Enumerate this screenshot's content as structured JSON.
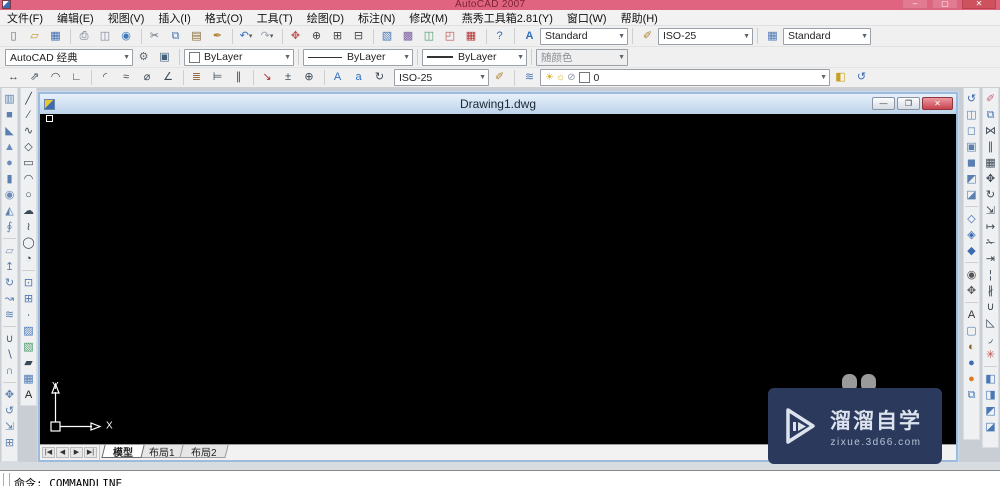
{
  "app": {
    "title": "AutoCAD 2007",
    "window_buttons": {
      "minimize": "–",
      "maximize": "▢",
      "close": "✕"
    }
  },
  "menu": {
    "items": [
      {
        "label": "文件(F)",
        "name": "menu-file"
      },
      {
        "label": "编辑(E)",
        "name": "menu-edit"
      },
      {
        "label": "视图(V)",
        "name": "menu-view"
      },
      {
        "label": "插入(I)",
        "name": "menu-insert"
      },
      {
        "label": "格式(O)",
        "name": "menu-format"
      },
      {
        "label": "工具(T)",
        "name": "menu-tools"
      },
      {
        "label": "绘图(D)",
        "name": "menu-draw"
      },
      {
        "label": "标注(N)",
        "name": "menu-dimension"
      },
      {
        "label": "修改(M)",
        "name": "menu-modify"
      },
      {
        "label": "燕秀工具箱2.81(Y)",
        "name": "menu-yanxiu-toolbox"
      },
      {
        "label": "窗口(W)",
        "name": "menu-window"
      },
      {
        "label": "帮助(H)",
        "name": "menu-help"
      }
    ]
  },
  "toolbar_standard": {
    "icons": [
      {
        "name": "new-icon",
        "glyph": "▯",
        "color": "#5a6b7a"
      },
      {
        "name": "open-icon",
        "glyph": "▱",
        "color": "#c9962a"
      },
      {
        "name": "save-icon",
        "glyph": "▦",
        "color": "#3c6bb0"
      },
      {
        "name": "plot-icon",
        "glyph": "⎙",
        "color": "#5a6b7a",
        "sep": true
      },
      {
        "name": "plot-preview-icon",
        "glyph": "◫",
        "color": "#7a8694"
      },
      {
        "name": "publish-icon",
        "glyph": "◉",
        "color": "#3f7ac0"
      },
      {
        "name": "cut-icon",
        "glyph": "✂",
        "color": "#5a6b7a",
        "sep": true
      },
      {
        "name": "copy-icon",
        "glyph": "⧉",
        "color": "#4a77b5"
      },
      {
        "name": "paste-icon",
        "glyph": "▤",
        "color": "#8a6d3b"
      },
      {
        "name": "match-properties-icon",
        "glyph": "✒",
        "color": "#b08030"
      },
      {
        "name": "undo-icon",
        "glyph": "↶",
        "color": "#2f6fc0",
        "sep": true,
        "dd": true
      },
      {
        "name": "redo-icon",
        "glyph": "↷",
        "color": "#9aa4af",
        "dd": true
      },
      {
        "name": "pan-realtime-icon",
        "glyph": "✥",
        "color": "#c05050",
        "sep": true
      },
      {
        "name": "zoom-realtime-icon",
        "glyph": "⊕",
        "color": "#444444"
      },
      {
        "name": "zoom-window-icon",
        "glyph": "⊞",
        "color": "#444444"
      },
      {
        "name": "zoom-previous-icon",
        "glyph": "⊟",
        "color": "#444444"
      },
      {
        "name": "properties-icon",
        "glyph": "▧",
        "color": "#4a77b5",
        "sep": true
      },
      {
        "name": "designcenter-icon",
        "glyph": "▩",
        "color": "#7a5fa0"
      },
      {
        "name": "tool-palettes-icon",
        "glyph": "◫",
        "color": "#4a9a6a"
      },
      {
        "name": "markup-set-manager-icon",
        "glyph": "◰",
        "color": "#c05050"
      },
      {
        "name": "quickcalc-icon",
        "glyph": "▦",
        "color": "#b03030"
      },
      {
        "name": "help-icon",
        "glyph": "?",
        "color": "#2f6fc0",
        "sep": true
      }
    ]
  },
  "toolbar_styles": {
    "text_style": {
      "icon_glyph": "A",
      "value": "Standard"
    },
    "dim_style": {
      "icon_glyph": "✐",
      "value": "ISO-25"
    },
    "table_style": {
      "icon_glyph": "▦",
      "value": "Standard"
    }
  },
  "toolbar_workspaces": {
    "value": "AutoCAD 经典",
    "icons": [
      {
        "name": "workspace-settings-icon",
        "glyph": "⚙",
        "color": "#5a6b7a"
      },
      {
        "name": "save-workspace-icon",
        "glyph": "▣",
        "color": "#44617e"
      }
    ]
  },
  "toolbar_properties": {
    "color": {
      "value": "ByLayer"
    },
    "linetype": {
      "value": "ByLayer"
    },
    "lineweight": {
      "value": "ByLayer"
    },
    "plot_style": {
      "value": "随颜色"
    }
  },
  "toolbar_dimension": {
    "icons": [
      {
        "name": "dim-linear-icon",
        "glyph": "↔",
        "color": "#3a4754"
      },
      {
        "name": "dim-aligned-icon",
        "glyph": "⇗",
        "color": "#3a4754"
      },
      {
        "name": "dim-arc-length-icon",
        "glyph": "◠",
        "color": "#3a4754"
      },
      {
        "name": "dim-ordinate-icon",
        "glyph": "∟",
        "color": "#3a4754"
      },
      {
        "name": "dim-radius-icon",
        "glyph": "◜",
        "color": "#3a4754",
        "sep": true
      },
      {
        "name": "dim-jogged-icon",
        "glyph": "≈",
        "color": "#3a4754"
      },
      {
        "name": "dim-diameter-icon",
        "glyph": "⌀",
        "color": "#3a4754"
      },
      {
        "name": "dim-angular-icon",
        "glyph": "∠",
        "color": "#3a4754"
      },
      {
        "name": "quick-dimension-icon",
        "glyph": "≣",
        "color": "#8a5a2a",
        "sep": true
      },
      {
        "name": "dim-baseline-icon",
        "glyph": "⊨",
        "color": "#3a4754"
      },
      {
        "name": "dim-continue-icon",
        "glyph": "∥",
        "color": "#3a4754"
      },
      {
        "name": "quick-leader-icon",
        "glyph": "↘",
        "color": "#b03030",
        "sep": true
      },
      {
        "name": "tolerance-icon",
        "glyph": "±",
        "color": "#3a4754"
      },
      {
        "name": "center-mark-icon",
        "glyph": "⊕",
        "color": "#3a4754"
      },
      {
        "name": "dim-edit-icon",
        "glyph": "A",
        "color": "#2f6fc0",
        "sep": true
      },
      {
        "name": "dim-text-edit-icon",
        "glyph": "a",
        "color": "#2f6fc0"
      },
      {
        "name": "dim-update-icon",
        "glyph": "↻",
        "color": "#3a4754"
      }
    ],
    "style_combo": {
      "value": "ISO-25"
    },
    "style_icon": {
      "glyph": "✐",
      "color": "#b08030"
    }
  },
  "toolbar_layers": {
    "manager_icon": {
      "glyph": "≋",
      "color": "#4a77b5"
    },
    "combo": {
      "icons": [
        {
          "name": "layer-on-icon",
          "glyph": "☀",
          "color": "#d8b020"
        },
        {
          "name": "layer-freeze-icon",
          "glyph": "☼",
          "color": "#d8b020"
        },
        {
          "name": "layer-lock-icon",
          "glyph": "⊘",
          "color": "#8a94a0"
        }
      ],
      "value": "0"
    },
    "icons": [
      {
        "name": "make-object-layer-current-icon",
        "glyph": "◧",
        "color": "#c8a020"
      },
      {
        "name": "layer-previous-icon",
        "glyph": "↺",
        "color": "#3c6bb0"
      }
    ]
  },
  "dock_left": {
    "modeling": [
      {
        "name": "polysolid-icon",
        "glyph": "▥",
        "color": "#5b7fb0"
      },
      {
        "name": "box-icon",
        "glyph": "■",
        "color": "#5b7fb0"
      },
      {
        "name": "wedge-icon",
        "glyph": "◣",
        "color": "#5b7fb0"
      },
      {
        "name": "cone-icon",
        "glyph": "▲",
        "color": "#6b8cba"
      },
      {
        "name": "sphere-icon",
        "glyph": "●",
        "color": "#6b8cba"
      },
      {
        "name": "cylinder-icon",
        "glyph": "▮",
        "color": "#5b7fb0"
      },
      {
        "name": "torus-icon",
        "glyph": "◉",
        "color": "#6b8cba"
      },
      {
        "name": "pyramid-icon",
        "glyph": "◭",
        "color": "#5b7fb0"
      },
      {
        "name": "helix-icon",
        "glyph": "∮",
        "color": "#5b7fb0"
      },
      {
        "name": "planar-surface-icon",
        "glyph": "▱",
        "color": "#8a9bb5",
        "sep": true
      },
      {
        "name": "extrude-icon",
        "glyph": "↥",
        "color": "#5b7fb0"
      },
      {
        "name": "revolve-icon",
        "glyph": "↻",
        "color": "#5b7fb0"
      },
      {
        "name": "sweep-icon",
        "glyph": "↝",
        "color": "#5b7fb0"
      },
      {
        "name": "loft-icon",
        "glyph": "≋",
        "color": "#5b7fb0"
      },
      {
        "name": "union-icon",
        "glyph": "∪",
        "color": "#44617e",
        "sep": true
      },
      {
        "name": "subtract-icon",
        "glyph": "∖",
        "color": "#44617e"
      },
      {
        "name": "intersect-icon",
        "glyph": "∩",
        "color": "#44617e"
      },
      {
        "name": "3d-move-icon",
        "glyph": "✥",
        "color": "#5b7fb0",
        "sep": true
      },
      {
        "name": "3d-rotate-icon",
        "glyph": "↺",
        "color": "#5b7fb0"
      },
      {
        "name": "3d-align-icon",
        "glyph": "⇲",
        "color": "#5b7fb0"
      },
      {
        "name": "3d-array-icon",
        "glyph": "⊞",
        "color": "#5b7fb0"
      }
    ],
    "draw": [
      {
        "name": "line-icon",
        "glyph": "╱",
        "color": "#3a4754"
      },
      {
        "name": "construction-line-icon",
        "glyph": "⁄",
        "color": "#3a4754"
      },
      {
        "name": "polyline-icon",
        "glyph": "∿",
        "color": "#3a4754"
      },
      {
        "name": "polygon-icon",
        "glyph": "◇",
        "color": "#3a4754"
      },
      {
        "name": "rectangle-icon",
        "glyph": "▭",
        "color": "#3a4754"
      },
      {
        "name": "arc-icon",
        "glyph": "◠",
        "color": "#3a4754"
      },
      {
        "name": "circle-icon",
        "glyph": "○",
        "color": "#3a4754"
      },
      {
        "name": "revision-cloud-icon",
        "glyph": "☁",
        "color": "#3a4754"
      },
      {
        "name": "spline-icon",
        "glyph": "≀",
        "color": "#3a4754"
      },
      {
        "name": "ellipse-icon",
        "glyph": "◯",
        "color": "#3a4754"
      },
      {
        "name": "ellipse-arc-icon",
        "glyph": "◔",
        "color": "#3a4754"
      },
      {
        "name": "insert-block-icon",
        "glyph": "⊡",
        "color": "#4a77b5",
        "sep": true
      },
      {
        "name": "make-block-icon",
        "glyph": "⊞",
        "color": "#4a77b5"
      },
      {
        "name": "point-icon",
        "glyph": "∙",
        "color": "#3a4754"
      },
      {
        "name": "hatch-icon",
        "glyph": "▨",
        "color": "#4a77b5"
      },
      {
        "name": "gradient-icon",
        "glyph": "▧",
        "color": "#4a9a6a"
      },
      {
        "name": "region-icon",
        "glyph": "▰",
        "color": "#3a4754"
      },
      {
        "name": "table-icon",
        "glyph": "▦",
        "color": "#4a77b5"
      },
      {
        "name": "mtext-icon",
        "glyph": "A",
        "color": "#222222"
      }
    ]
  },
  "dock_right": {
    "view": [
      {
        "name": "free-orbit-icon",
        "glyph": "↺",
        "color": "#3c6bb0"
      },
      {
        "name": "visual-style-2d-wireframe-icon",
        "glyph": "◫",
        "color": "#5b7fb0"
      },
      {
        "name": "visual-style-3d-wireframe-icon",
        "glyph": "◻",
        "color": "#5b7fb0"
      },
      {
        "name": "visual-style-3d-hidden-icon",
        "glyph": "▣",
        "color": "#5b7fb0"
      },
      {
        "name": "visual-style-realistic-icon",
        "glyph": "◼",
        "color": "#5b7fb0"
      },
      {
        "name": "visual-style-conceptual-icon",
        "glyph": "◩",
        "color": "#5b7fb0"
      },
      {
        "name": "visual-styles-manager-icon",
        "glyph": "◪",
        "color": "#5b7fb0"
      },
      {
        "name": "shadows-off-icon",
        "glyph": "◇",
        "color": "#3c6bb0",
        "sep": true
      },
      {
        "name": "ground-shadows-icon",
        "glyph": "◈",
        "color": "#3c6bb0"
      },
      {
        "name": "full-shadows-icon",
        "glyph": "◆",
        "color": "#3c6bb0"
      },
      {
        "name": "camera-icon",
        "glyph": "◉",
        "color": "#555555",
        "sep": true
      },
      {
        "name": "walk-icon",
        "glyph": "✥",
        "color": "#555555"
      },
      {
        "name": "named-views-icon",
        "glyph": "A",
        "color": "#333333",
        "sep": true
      },
      {
        "name": "hide-icon",
        "glyph": "▢",
        "color": "#5b7fb0"
      },
      {
        "name": "render-icon",
        "glyph": "◐",
        "color": "#806020"
      },
      {
        "name": "render-preferences-icon",
        "glyph": "●",
        "color": "#3c6bb0"
      },
      {
        "name": "lights-icon",
        "glyph": "●",
        "color": "#e07820"
      },
      {
        "name": "materials-icon",
        "glyph": "⧉",
        "color": "#4a77b5"
      }
    ],
    "modify": [
      {
        "name": "erase-icon",
        "glyph": "✐",
        "color": "#d06080"
      },
      {
        "name": "copy-object-icon",
        "glyph": "⧉",
        "color": "#4a77b5"
      },
      {
        "name": "mirror-icon",
        "glyph": "⋈",
        "color": "#3a4754"
      },
      {
        "name": "offset-icon",
        "glyph": "∥",
        "color": "#3a4754"
      },
      {
        "name": "array-icon",
        "glyph": "▦",
        "color": "#3a4754"
      },
      {
        "name": "move-icon",
        "glyph": "✥",
        "color": "#3a4754"
      },
      {
        "name": "rotate-icon",
        "glyph": "↻",
        "color": "#3a4754"
      },
      {
        "name": "scale-icon",
        "glyph": "⇲",
        "color": "#3a4754"
      },
      {
        "name": "stretch-icon",
        "glyph": "↦",
        "color": "#3a4754"
      },
      {
        "name": "trim-icon",
        "glyph": "✁",
        "color": "#3a4754"
      },
      {
        "name": "extend-icon",
        "glyph": "⇥",
        "color": "#3a4754"
      },
      {
        "name": "break-at-point-icon",
        "glyph": "¦",
        "color": "#3a4754"
      },
      {
        "name": "break-icon",
        "glyph": "∦",
        "color": "#3a4754"
      },
      {
        "name": "join-icon",
        "glyph": "∪",
        "color": "#3a4754"
      },
      {
        "name": "chamfer-icon",
        "glyph": "◺",
        "color": "#3a4754"
      },
      {
        "name": "fillet-icon",
        "glyph": "◞",
        "color": "#3a4754"
      },
      {
        "name": "explode-icon",
        "glyph": "✳",
        "color": "#c05050"
      },
      {
        "name": "bring-to-front-icon",
        "glyph": "◧",
        "color": "#4a77b5",
        "sep": true
      },
      {
        "name": "send-to-back-icon",
        "glyph": "◨",
        "color": "#4a77b5"
      },
      {
        "name": "bring-above-objects-icon",
        "glyph": "◩",
        "color": "#4a77b5"
      },
      {
        "name": "send-under-objects-icon",
        "glyph": "◪",
        "color": "#4a77b5"
      }
    ]
  },
  "document": {
    "title": "Drawing1.dwg",
    "window_buttons": {
      "minimize": "—",
      "restore": "❐",
      "close": "✕"
    },
    "tab_nav": [
      {
        "name": "tab-first-button",
        "glyph": "|◀"
      },
      {
        "name": "tab-prev-button",
        "glyph": "◀"
      },
      {
        "name": "tab-next-button",
        "glyph": "▶"
      },
      {
        "name": "tab-last-button",
        "glyph": "▶|"
      }
    ],
    "tabs": [
      {
        "label": "模型",
        "name": "tab-model",
        "active": true
      },
      {
        "label": "布局1",
        "name": "tab-layout1"
      },
      {
        "label": "布局2",
        "name": "tab-layout2"
      }
    ],
    "ucs": {
      "x": "X",
      "y": "Y"
    }
  },
  "watermark": {
    "brand": "溜溜自学",
    "url": "zixue.3d66.com"
  },
  "command_line": {
    "text": "命令: COMMANDLINE"
  },
  "colors": {
    "titlebar": "#e0647f",
    "doc_title_top": "#e7f1fb",
    "watermark_bg": "#2b3a5c",
    "canvas": "#000000"
  }
}
